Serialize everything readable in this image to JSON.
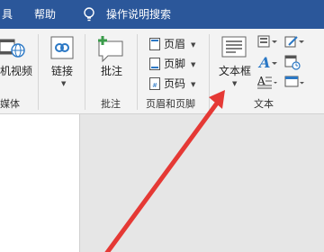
{
  "menu_bar": {
    "tab_partial": "具",
    "tab_help": "帮助",
    "tell_me": "操作说明搜索"
  },
  "ribbon": {
    "media": {
      "online_video_label": "机视频",
      "group_label": "媒体"
    },
    "links": {
      "link_label": "链接"
    },
    "comments": {
      "comment_label": "批注",
      "group_label": "批注"
    },
    "header_footer": {
      "header_label": "页眉",
      "footer_label": "页脚",
      "page_number_label": "页码",
      "group_label": "页眉和页脚"
    },
    "text": {
      "textbox_label": "文本框",
      "group_label": "文本"
    }
  },
  "colors": {
    "title_bar": "#2b579a",
    "ribbon_bg": "#f3f3f3",
    "arrow": "#e53935"
  },
  "annotation": {
    "type": "arrow",
    "points_to": "textbox-button"
  }
}
